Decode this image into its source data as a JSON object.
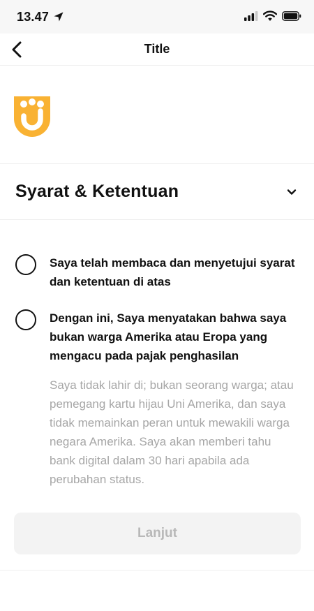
{
  "status_bar": {
    "time": "13.47"
  },
  "nav": {
    "title": "Title"
  },
  "brand": {
    "logo_color": "#F9B233"
  },
  "terms_section": {
    "title": "Syarat & Ketentuan"
  },
  "agreements": [
    {
      "label": "Saya telah membaca dan menyetujui syarat dan ketentuan di atas",
      "checked": false
    },
    {
      "label": "Dengan ini, Saya menyatakan bahwa saya bukan warga Amerika atau Eropa yang mengacu pada pajak penghasilan",
      "checked": false
    }
  ],
  "disclaimer": "Saya tidak lahir di; bukan seorang warga; atau pemegang kartu hijau Uni Amerika, dan saya tidak memainkan peran untuk mewakili warga negara Amerika. Saya akan memberi tahu bank digital dalam 30 hari apabila ada perubahan status.",
  "submit_button": {
    "label": "Lanjut",
    "enabled": false
  }
}
